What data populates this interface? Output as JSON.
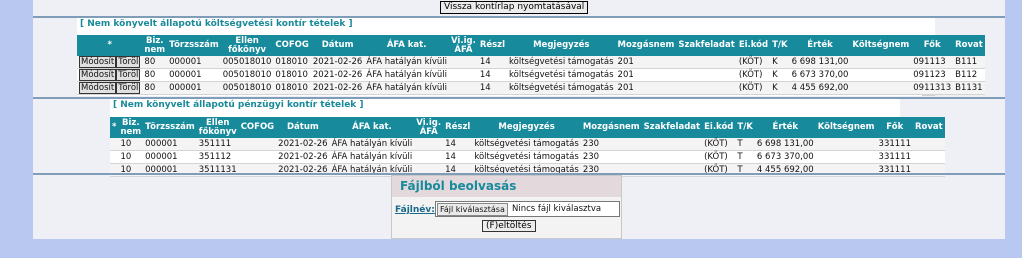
{
  "top_button": "Vissza kontírlap nyomtatásával",
  "section1": {
    "title": "[ Nem könyvelt állapotú költségvetési kontír tételek ]",
    "headers": [
      "*",
      "Biz. nem",
      "Törzsszám",
      "Ellen főkönyv",
      "COFOG",
      "Dátum",
      "ÁFA kat.",
      "Vi.ig. ÁFA",
      "Részl",
      "Megjegyzés",
      "Mozgásnem",
      "Szakfeladat",
      "Ei.kód",
      "T/K",
      "Érték",
      "Költségnem",
      "Fők",
      "Rovat"
    ],
    "modify_label": "Módosít",
    "delete_label": "Töröl",
    "rows": [
      [
        "80",
        "000001",
        "005018010",
        "018010",
        "2021-02-26",
        "ÁFA hatályán kívüli",
        "",
        "14",
        "költségvetési támogatás",
        "201",
        "",
        "(KÖT)",
        "K",
        "6 698 131,00",
        "",
        "091113",
        "B111"
      ],
      [
        "80",
        "000001",
        "005018010",
        "018010",
        "2021-02-26",
        "ÁFA hatályán kívüli",
        "",
        "14",
        "költségvetési támogatás",
        "201",
        "",
        "(KÖT)",
        "K",
        "6 673 370,00",
        "",
        "091123",
        "B112"
      ],
      [
        "80",
        "000001",
        "005018010",
        "018010",
        "2021-02-26",
        "ÁFA hatályán kívüli",
        "",
        "14",
        "költségvetési támogatás",
        "201",
        "",
        "(KÖT)",
        "K",
        "4 455 692,00",
        "",
        "0911313",
        "B1131"
      ]
    ]
  },
  "section2": {
    "title": "[ Nem könyvelt állapotú pénzügyi kontír tételek ]",
    "headers": [
      "*",
      "Biz. nem",
      "Törzsszám",
      "Ellen főkönyv",
      "COFOG",
      "Dátum",
      "ÁFA kat.",
      "Vi.ig. ÁFA",
      "Részl",
      "Megjegyzés",
      "Mozgásnem",
      "Szakfeladat",
      "Ei.kód",
      "T/K",
      "Érték",
      "Költségnem",
      "Fők",
      "Rovat"
    ],
    "rows": [
      [
        "10",
        "000001",
        "351111",
        "",
        "2021-02-26",
        "ÁFA hatályán kívüli",
        "",
        "14",
        "költségvetési támogatás",
        "230",
        "",
        "(KÖT)",
        "T",
        "6 698 131,00",
        "",
        "331111",
        ""
      ],
      [
        "10",
        "000001",
        "351112",
        "",
        "2021-02-26",
        "ÁFA hatályán kívüli",
        "",
        "14",
        "költségvetési támogatás",
        "230",
        "",
        "(KÖT)",
        "T",
        "6 673 370,00",
        "",
        "331111",
        ""
      ],
      [
        "10",
        "000001",
        "3511131",
        "",
        "2021-02-26",
        "ÁFA hatályán kívüli",
        "",
        "14",
        "költségvetési támogatás",
        "230",
        "",
        "(KÖT)",
        "T",
        "4 455 692,00",
        "",
        "331111",
        ""
      ]
    ]
  },
  "upload": {
    "title": "Fájlból beolvasás",
    "field_label": "Fájlnév:",
    "choose_button": "Fájl kiválasztása",
    "no_file_text": "Nincs fájl kiválasztva",
    "upload_button": "(F)eltöltés"
  }
}
